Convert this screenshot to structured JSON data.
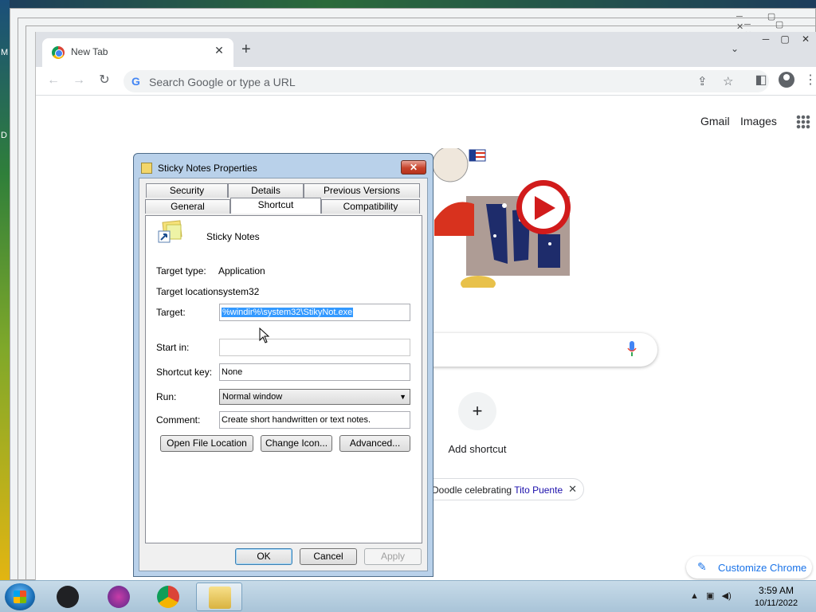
{
  "desktop": {
    "label_m": "M",
    "label_d": "D"
  },
  "browser": {
    "tab_title": "New Tab",
    "tab_close": "✕",
    "new_tab": "+",
    "tab_search": "⌄",
    "omnibox_placeholder": "Search Google or type a URL",
    "ntp_links": {
      "gmail": "Gmail",
      "images": "Images"
    },
    "add_shortcut": "Add shortcut",
    "doodle_chip_prefix": "Doodle celebrating ",
    "doodle_chip_link": "Tito Puente",
    "doodle_chip_close": "✕",
    "customize": "Customize Chrome"
  },
  "dialog": {
    "title": "Sticky Notes Properties",
    "close": "✕",
    "tabs_row1": [
      "Security",
      "Details",
      "Previous Versions"
    ],
    "tabs_row2": [
      "General",
      "Shortcut",
      "Compatibility"
    ],
    "active_tab": "Shortcut",
    "app_name": "Sticky Notes",
    "target_type_label": "Target type:",
    "target_type_value": "Application",
    "target_location_label": "Target location:",
    "target_location_value": "system32",
    "target_label": "Target:",
    "target_value": "%windir%\\system32\\StikyNot.exe",
    "start_in_label": "Start in:",
    "start_in_value": "",
    "shortcut_key_label": "Shortcut key:",
    "shortcut_key_value": "None",
    "run_label": "Run:",
    "run_value": "Normal window",
    "comment_label": "Comment:",
    "comment_value": "Create short handwritten or text notes.",
    "buttons": {
      "open_file_location": "Open File Location",
      "change_icon": "Change Icon...",
      "advanced": "Advanced...",
      "ok": "OK",
      "cancel": "Cancel",
      "apply": "Apply"
    }
  },
  "taskbar": {
    "time": "3:59 AM",
    "date": "10/11/2022"
  }
}
